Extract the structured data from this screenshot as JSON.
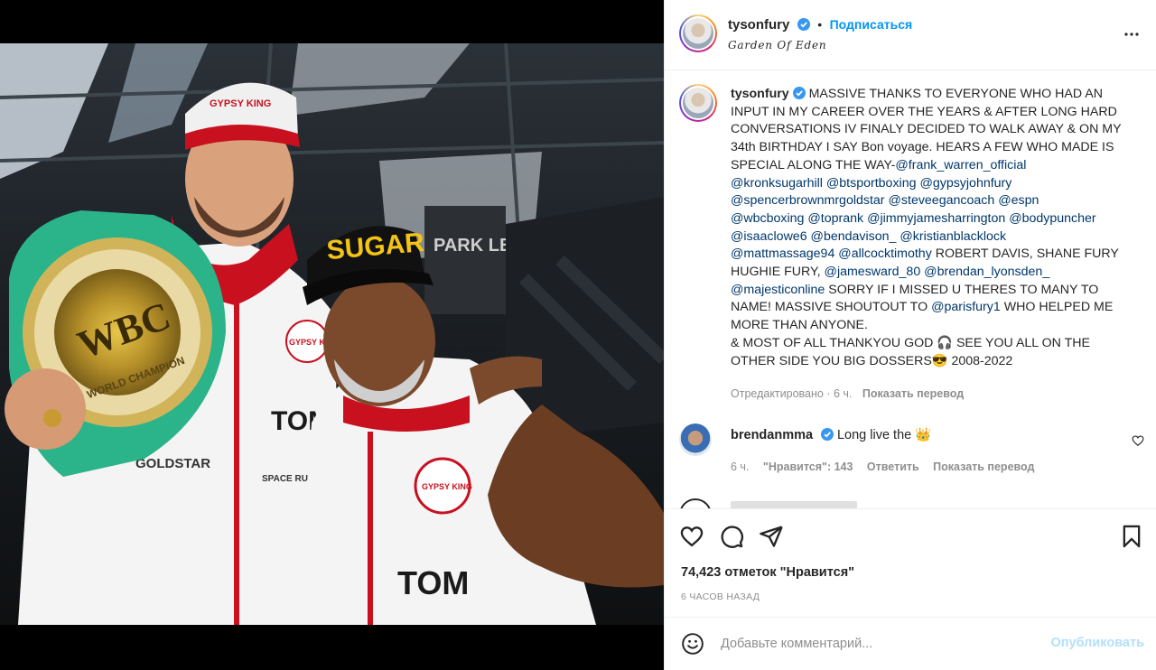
{
  "post": {
    "username": "tysonfury",
    "follow_label": "Подписаться",
    "location": "Garden Of Eden",
    "more_icon": "more-horizontal-icon"
  },
  "caption": {
    "username": "tysonfury",
    "lines": [
      [
        {
          "t": "MASSIVE THANKS TO EVERYONE WHO HAD AN",
          "m": false
        }
      ],
      [
        {
          "t": "INPUT IN MY CAREER OVER THE YEARS & AFTER LONG HARD",
          "m": false
        }
      ],
      [
        {
          "t": "CONVERSATIONS IV FINALY DECIDED TO WALK AWAY & ON MY",
          "m": false
        }
      ],
      [
        {
          "t": "34th BIRTHDAY I SAY Bon voyage. HEARS A FEW WHO MADE IS",
          "m": false
        }
      ],
      [
        {
          "t": "SPECIAL ALONG THE WAY-",
          "m": false
        },
        {
          "t": "@frank_warren_official",
          "m": true
        }
      ],
      [
        {
          "t": "@kronksugarhill",
          "m": true
        },
        {
          "t": " ",
          "m": false
        },
        {
          "t": "@btsportboxing",
          "m": true
        },
        {
          "t": " ",
          "m": false
        },
        {
          "t": "@gypsyjohnfury",
          "m": true
        }
      ],
      [
        {
          "t": "@spencerbrownmrgoldstar",
          "m": true
        },
        {
          "t": " ",
          "m": false
        },
        {
          "t": "@steveegancoach",
          "m": true
        },
        {
          "t": " ",
          "m": false
        },
        {
          "t": "@espn",
          "m": true
        }
      ],
      [
        {
          "t": "@wbcboxing",
          "m": true
        },
        {
          "t": " ",
          "m": false
        },
        {
          "t": "@toprank",
          "m": true
        },
        {
          "t": " ",
          "m": false
        },
        {
          "t": "@jimmyjamesharrington",
          "m": true
        },
        {
          "t": " ",
          "m": false
        },
        {
          "t": "@bodypuncher",
          "m": true
        }
      ],
      [
        {
          "t": "@isaaclowe6",
          "m": true
        },
        {
          "t": " ",
          "m": false
        },
        {
          "t": "@bendavison_",
          "m": true
        },
        {
          "t": " ",
          "m": false
        },
        {
          "t": "@kristianblacklock",
          "m": true
        }
      ],
      [
        {
          "t": "@mattmassage94",
          "m": true
        },
        {
          "t": " ",
          "m": false
        },
        {
          "t": "@allcocktimothy",
          "m": true
        },
        {
          "t": " ROBERT DAVIS, SHANE FURY",
          "m": false
        }
      ],
      [
        {
          "t": "HUGHIE FURY, ",
          "m": false
        },
        {
          "t": "@jamesward_80",
          "m": true
        },
        {
          "t": " ",
          "m": false
        },
        {
          "t": "@brendan_lyonsden_",
          "m": true
        }
      ],
      [
        {
          "t": "@majesticonline",
          "m": true
        },
        {
          "t": " SORRY IF I MISSED U THERES TO MANY TO",
          "m": false
        }
      ],
      [
        {
          "t": "NAME! MASSIVE SHOUTOUT TO ",
          "m": false
        },
        {
          "t": "@parisfury1",
          "m": true
        },
        {
          "t": " WHO HELPED ME",
          "m": false
        }
      ],
      [
        {
          "t": "MORE THAN ANYONE.",
          "m": false
        }
      ],
      [
        {
          "t": "& MOST OF ALL THANKYOU GOD 🎧 SEE YOU ALL ON THE",
          "m": false
        }
      ],
      [
        {
          "t": "OTHER SIDE YOU BIG DOSSERS😎 2008-2022",
          "m": false
        }
      ]
    ],
    "edited": "Отредактировано · 6 ч.",
    "translate": "Показать перевод"
  },
  "comments": [
    {
      "username": "brendanmma",
      "text": "Long live the 👑",
      "time": "6 ч.",
      "likes": "\"Нравится\": 143",
      "reply": "Ответить",
      "translate": "Показать перевод"
    }
  ],
  "actions": {
    "like_icon": "heart-icon",
    "comment_icon": "comment-icon",
    "share_icon": "send-icon",
    "save_icon": "bookmark-icon",
    "likes_label": "74,423 отметок \"Нравится\"",
    "timestamp": "6 ЧАСОВ НАЗАД"
  },
  "comment_box": {
    "emoji_icon": "emoji-icon",
    "placeholder": "Добавьте комментарий...",
    "publish_label": "Опубликовать"
  },
  "photo": {
    "belt_label": "WBC",
    "belt_ring_text": "WORLD CHAMPION",
    "cap_left": "GYPSY KING",
    "cap_right": "SUGAR",
    "patch_left": "GYPSY KING",
    "patch_right": "GYPSY KING",
    "sponsor_1": "TOM",
    "sponsor_2": "TOM",
    "sponsor_3": "GOLDSTAR",
    "sponsor_4": "SPACE RUNNER",
    "sign_text": "PARK LEY"
  },
  "colors": {
    "accent_blue": "#0095f6",
    "mention_blue": "#00376b",
    "muted": "#8e8e8e",
    "publish_disabled": "#b2dffc"
  }
}
